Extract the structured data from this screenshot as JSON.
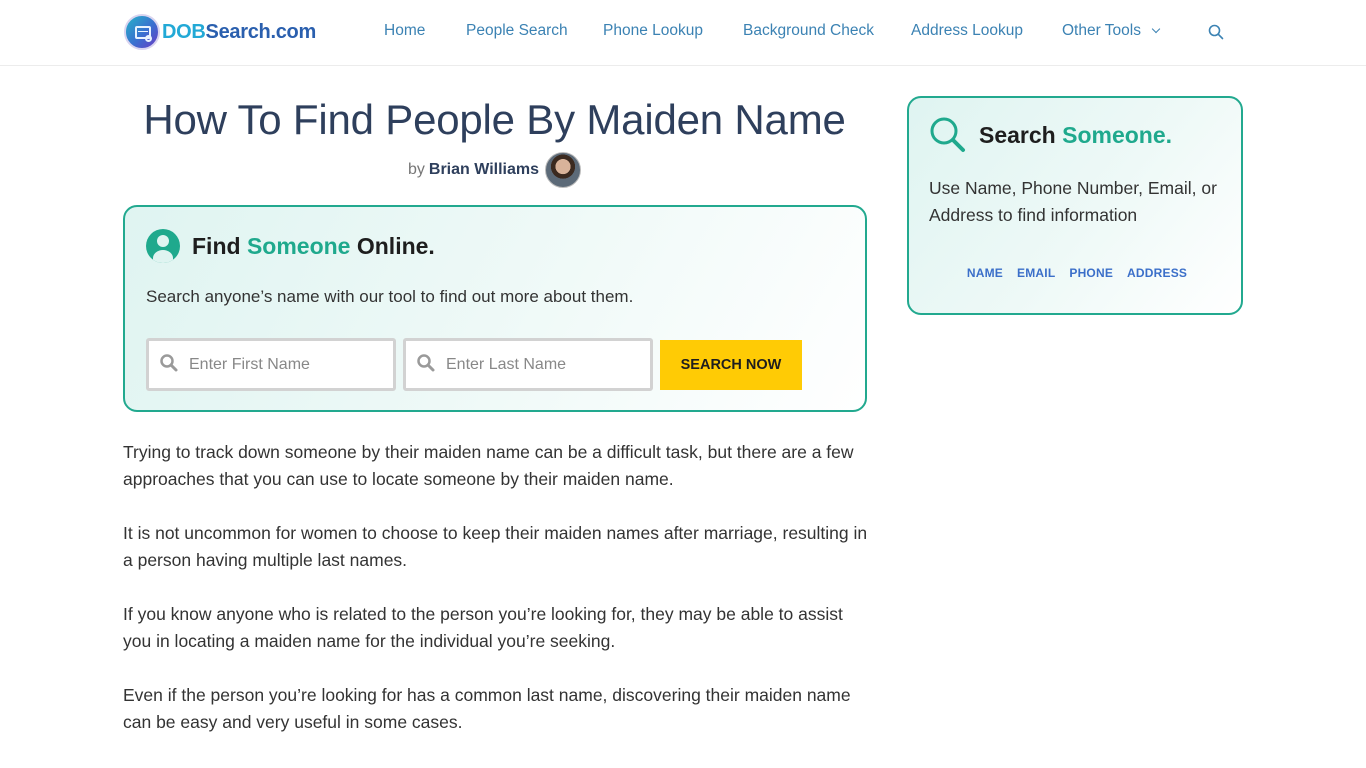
{
  "brand": {
    "logo_part1": "DOB",
    "logo_part2": "Search.com"
  },
  "nav": {
    "items": [
      {
        "label": "Home"
      },
      {
        "label": "People Search"
      },
      {
        "label": "Phone Lookup"
      },
      {
        "label": "Background Check"
      },
      {
        "label": "Address Lookup"
      },
      {
        "label": "Other Tools",
        "has_dropdown": true
      }
    ],
    "search_icon": "search-icon"
  },
  "article": {
    "title": "How To Find People By Maiden Name",
    "byline_prefix": "by",
    "author": "Brian Williams",
    "paragraphs": [
      "Trying to track down someone by their maiden name can be a difficult task, but there are a few approaches that you can use to locate someone by their maiden name.",
      "It is not uncommon for women to choose to keep their maiden names after marriage, resulting in a person having multiple last names.",
      "If you know anyone who is related to the person you’re looking for, they may be able to assist you in locating a maiden name for the individual you’re seeking.",
      "Even if the person you’re looking for has a common last name, discovering their maiden name can be easy and very useful in some cases."
    ]
  },
  "find_widget": {
    "title_part1": "Find",
    "title_accent": "Someone",
    "title_part2": "Online.",
    "description": "Search anyone’s name with our tool to find out more about them.",
    "first_name": {
      "value": "",
      "placeholder": "Enter First Name"
    },
    "last_name": {
      "value": "",
      "placeholder": "Enter Last Name"
    },
    "button_label": "SEARCH NOW"
  },
  "sidebar_widget": {
    "title_part1": "Search",
    "title_accent": "Someone.",
    "description": "Use Name, Phone Number, Email, or Address to find information",
    "links": [
      "NAME",
      "EMAIL",
      "PHONE",
      "ADDRESS"
    ]
  },
  "colors": {
    "accent": "#1fa98d",
    "nav_link": "#3b82b3",
    "title": "#2e3f5c",
    "button": "#ffcb05",
    "sidebar_link": "#3b6fc9"
  }
}
